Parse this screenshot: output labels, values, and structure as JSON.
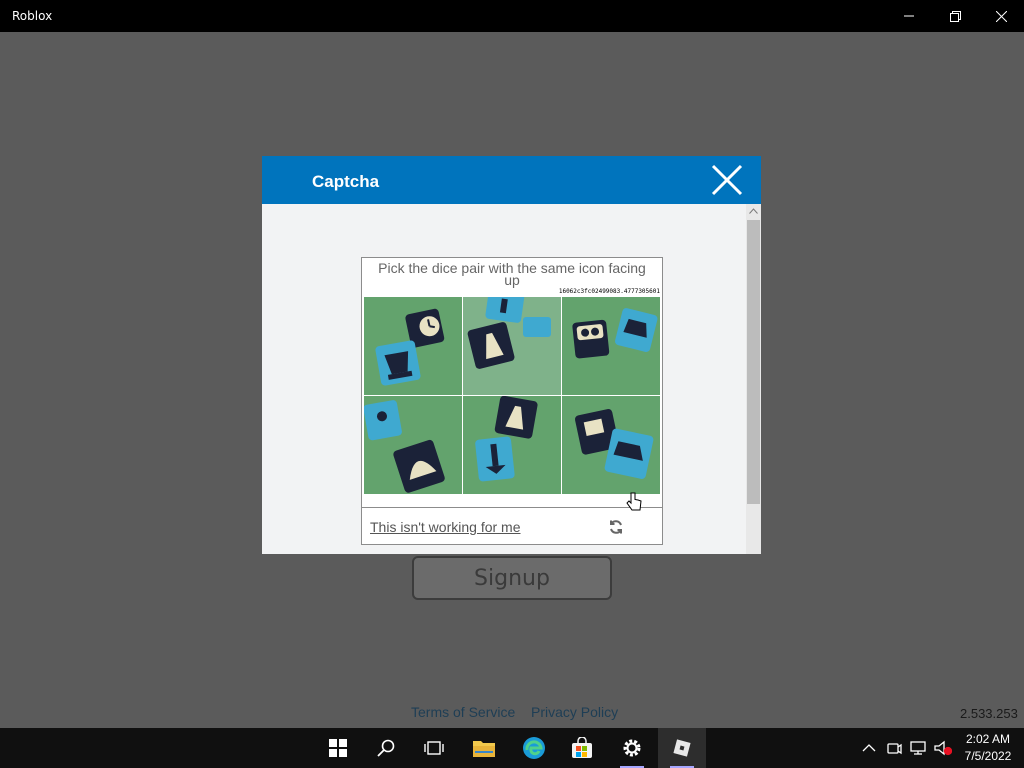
{
  "window": {
    "title": "Roblox"
  },
  "app": {
    "signup_label": "Signup",
    "footer": {
      "tos": "Terms of Service",
      "privacy": "Privacy Policy"
    },
    "version": "2.533.253"
  },
  "captcha_modal": {
    "title": "Captcha",
    "prompt": "Pick the dice pair with the same icon facing up",
    "token": "16062c3fc02499083.4777305601",
    "selected_tile": 2,
    "help_link": "This isn't working for me"
  },
  "taskbar": {
    "apps": [
      "start-icon",
      "search-icon",
      "task-view-icon",
      "file-explorer-icon",
      "edge-icon",
      "store-icon",
      "settings-icon",
      "roblox-icon"
    ],
    "clock": {
      "time": "2:02 AM",
      "date": "7/5/2022"
    }
  },
  "colors": {
    "header_blue": "#0074bd",
    "overlay_gray": "#5b5b5b",
    "taskbar": "#101010"
  }
}
